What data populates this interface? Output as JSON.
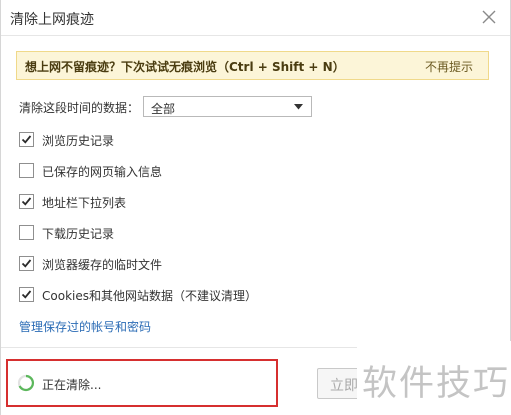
{
  "dialog": {
    "title": "清除上网痕迹",
    "close_icon": "close-icon"
  },
  "hint": {
    "text": "想上网不留痕迹？下次试试无痕浏览（Ctrl + Shift + N）",
    "dismiss_label": "不再提示"
  },
  "range": {
    "label": "清除这段时间的数据：",
    "selected": "全部"
  },
  "options": [
    {
      "label": "浏览历史记录",
      "checked": true
    },
    {
      "label": "已保存的网页输入信息",
      "checked": false
    },
    {
      "label": "地址栏下拉列表",
      "checked": true
    },
    {
      "label": "下载历史记录",
      "checked": false
    },
    {
      "label": "浏览器缓存的临时文件",
      "checked": true
    },
    {
      "label": "Cookies和其他网站数据（不建议清理）",
      "checked": true
    }
  ],
  "manage_link": "管理保存过的帐号和密码",
  "status": {
    "text": "正在清除..."
  },
  "buttons": {
    "now_label": "立即清除"
  },
  "watermark": "软件技巧",
  "colors": {
    "accent_link": "#2a6bb5",
    "hint_bg": "#fcf5d8",
    "highlight_border": "#d62f2f",
    "spinner": "#5cb85c"
  }
}
